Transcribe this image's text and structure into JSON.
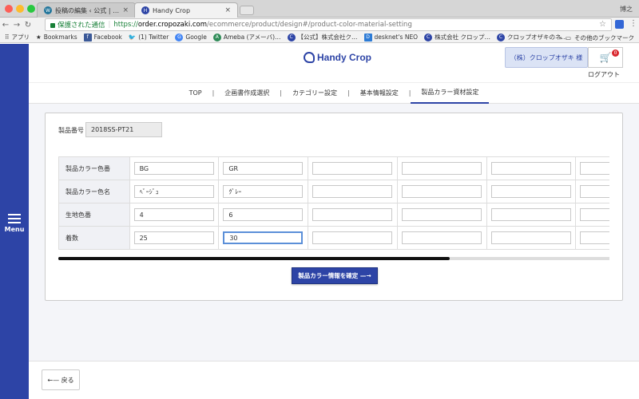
{
  "browser": {
    "tabs": [
      {
        "title": "投稿の編集 ‹ 公式 | 株式会社ク…",
        "favicon": "wordpress-icon"
      },
      {
        "title": "Handy Crop",
        "favicon": "handy-crop-icon"
      }
    ],
    "user": "博之",
    "secure_label": "保護された通信",
    "url": {
      "proto": "https://",
      "host": "order.cropozaki.com",
      "path": "/ecommerce/product/design#/product-color-material-setting"
    },
    "bookmarks": [
      "アプリ",
      "Bookmarks",
      "Facebook",
      "(1) Twitter",
      "Google",
      "Ameba (アメーバ)…",
      "【公式】株式会社ク…",
      "desknet's NEO",
      "株式会社 クロップ…",
      "クロップオザキのネ…"
    ],
    "other_bookmarks": "その他のブックマーク"
  },
  "sidebar": {
    "menu_label": "Menu"
  },
  "header": {
    "logo": "Handy Crop",
    "company": "（株）クロップオザキ 様",
    "cart_badge": "0",
    "logout": "ログアウト"
  },
  "nav": {
    "items": [
      "TOP",
      "企画書作成選択",
      "カテゴリー設定",
      "基本情報設定",
      "製品カラー資材設定"
    ],
    "separator": "|",
    "active_index": 4
  },
  "form": {
    "product_number_label": "製品番号",
    "product_number": "2018SS-PT21",
    "rows": [
      {
        "label": "製品カラー色番",
        "values": [
          "BG",
          "GR",
          "",
          "",
          "",
          ""
        ]
      },
      {
        "label": "製品カラー色名",
        "values": [
          "ﾍﾞｰｼﾞｭ",
          "ｸﾞﾚｰ",
          "",
          "",
          "",
          ""
        ]
      },
      {
        "label": "生地色番",
        "values": [
          "4",
          "6",
          "",
          "",
          "",
          ""
        ]
      },
      {
        "label": "着数",
        "values": [
          "25",
          "30",
          "",
          "",
          "",
          ""
        ]
      }
    ],
    "confirm_button": "製品カラー情報を確定 —→"
  },
  "footer": {
    "back_button": "←— 戻る"
  },
  "colors": {
    "brand": "#2d44a6",
    "sidebar": "#2d44a6",
    "page_bg": "#f4f5f9"
  }
}
